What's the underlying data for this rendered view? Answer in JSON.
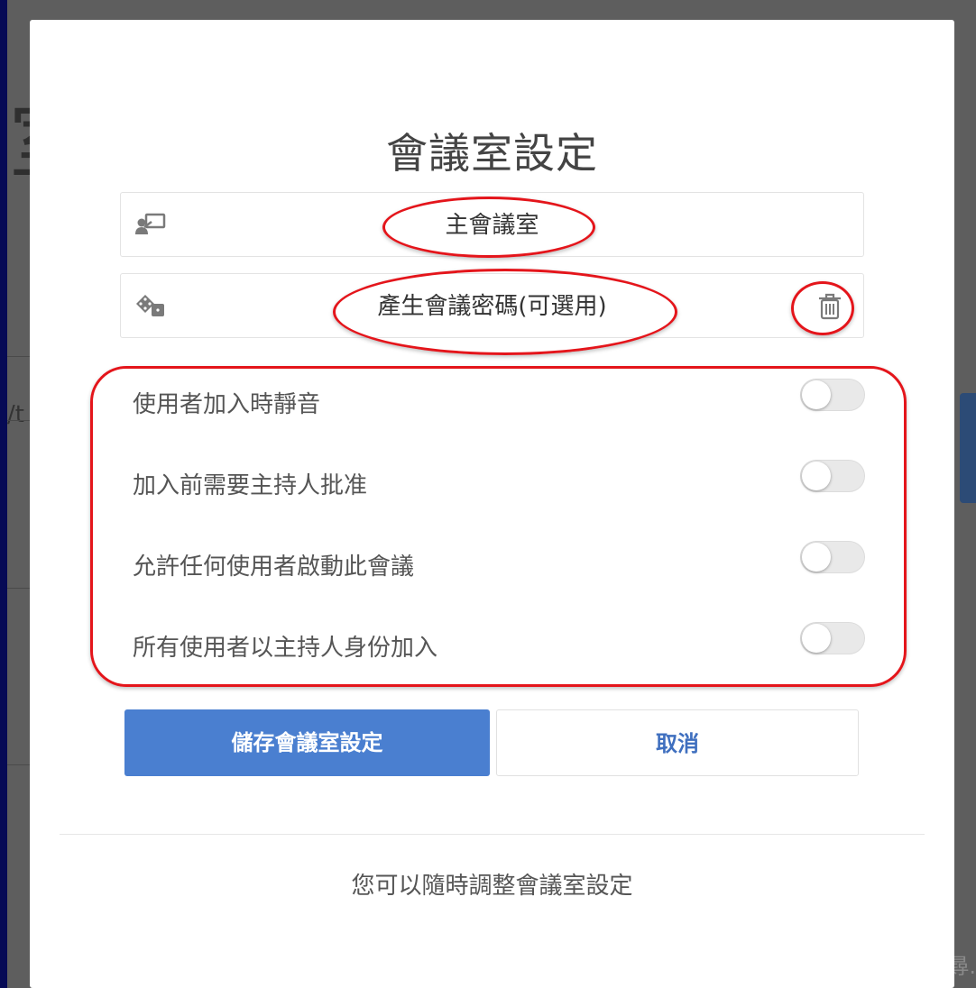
{
  "background": {
    "heading_fragment": "室",
    "url_fragment": "/t",
    "footer_fragment": "尋."
  },
  "modal": {
    "title": "會議室設定",
    "room_name": {
      "icon": "presentation-icon",
      "value": "主會議室"
    },
    "access_code": {
      "icon": "dice-icon",
      "value": "產生會議密碼(可選用)",
      "delete_icon": "trash-icon"
    },
    "options": [
      {
        "label": "使用者加入時靜音",
        "enabled": false
      },
      {
        "label": "加入前需要主持人批准",
        "enabled": false
      },
      {
        "label": "允許任何使用者啟動此會議",
        "enabled": false
      },
      {
        "label": "所有使用者以主持人身份加入",
        "enabled": false
      }
    ],
    "buttons": {
      "save_label": "儲存會議室設定",
      "cancel_label": "取消"
    },
    "footer_text": "您可以隨時調整會議室設定"
  },
  "colors": {
    "frame": "#060a55",
    "primary": "#4a7fd0",
    "annotation": "#e4151b"
  }
}
